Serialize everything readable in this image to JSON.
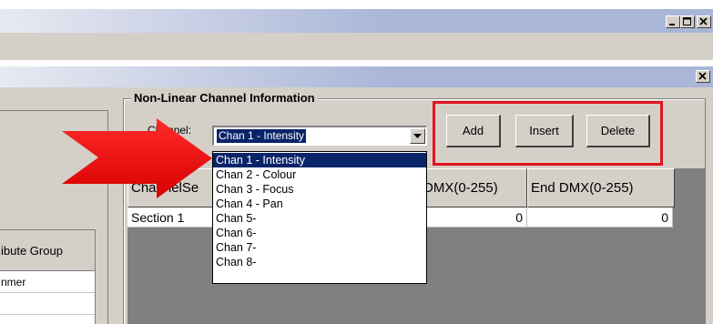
{
  "colors": {
    "highlight_red": "#e0141e",
    "selection_blue": "#0a246a",
    "window_face": "#d4d0c8",
    "callout_red": "#ee1111"
  },
  "icons": {
    "minimize": "minimize-icon",
    "maximize": "maximize-icon",
    "close": "close-icon",
    "combo_arrow": "chevron-down-icon",
    "callout": "red-arrow-callout"
  },
  "group": {
    "title": "Non-Linear Channel Information"
  },
  "channel": {
    "label": "Channel:",
    "selected": "Chan 1 - Intensity",
    "options": [
      "Chan 1 - Intensity",
      "Chan 2 - Colour",
      "Chan 3 - Focus",
      "Chan 4 - Pan",
      "Chan 5-",
      "Chan 6-",
      "Chan 7-",
      "Chan 8-"
    ]
  },
  "buttons": {
    "add": "Add",
    "insert": "Insert",
    "delete": "Delete"
  },
  "grid": {
    "columns": [
      "ChannelSe",
      "DMX(0-255)",
      "End DMX(0-255)"
    ],
    "rows": [
      {
        "section": "Section 1",
        "start": "0",
        "end": "0"
      }
    ]
  },
  "left_table": {
    "header": "ibute Group",
    "rows": [
      "nmer"
    ]
  }
}
